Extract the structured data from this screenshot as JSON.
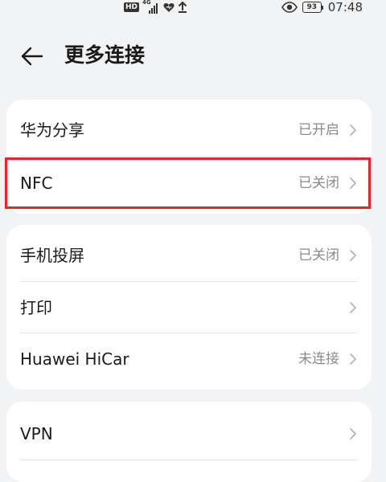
{
  "status_bar": {
    "hd_label": "HD",
    "network_type": "4G",
    "battery_level": "93",
    "time": "07:48",
    "icons": [
      "hd-icon",
      "signal-icon",
      "heart-icon",
      "upload-icon",
      "eye-icon",
      "battery-icon"
    ]
  },
  "header": {
    "back_icon": "arrow-left-icon",
    "title": "更多连接"
  },
  "groups": [
    {
      "items": [
        {
          "label": "华为分享",
          "value": "已开启"
        },
        {
          "label": "NFC",
          "value": "已关闭"
        }
      ]
    },
    {
      "items": [
        {
          "label": "手机投屏",
          "value": "已关闭"
        },
        {
          "label": "打印",
          "value": ""
        },
        {
          "label": "Huawei HiCar",
          "value": "未连接"
        }
      ]
    },
    {
      "items": [
        {
          "label": "VPN",
          "value": ""
        }
      ]
    }
  ],
  "colors": {
    "background": "#f1f3f5",
    "card": "#ffffff",
    "highlight": "#e8242f",
    "secondary_text": "#8a8a8a"
  }
}
